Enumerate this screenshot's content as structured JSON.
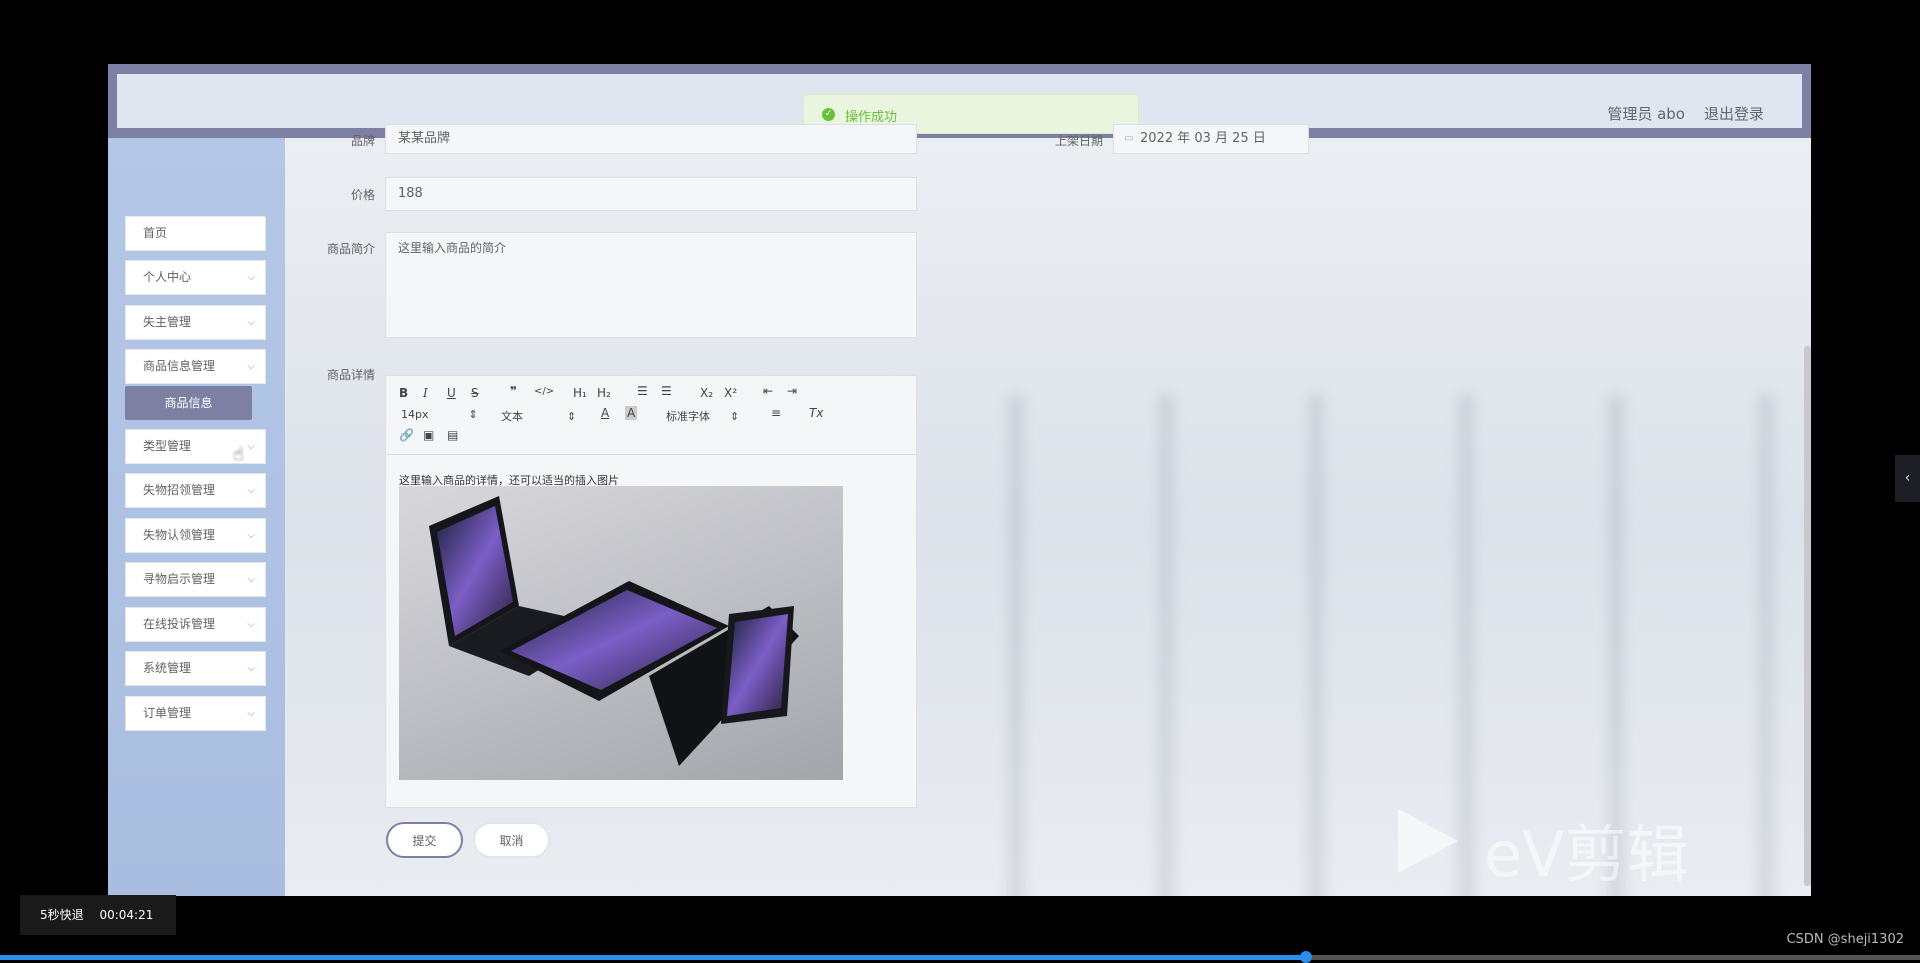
{
  "header": {
    "admin_label": "管理员 abo",
    "logout_label": "退出登录"
  },
  "toast": {
    "message": "操作成功"
  },
  "sidebar": {
    "items": [
      {
        "label": "首页",
        "has_arrow": false
      },
      {
        "label": "个人中心",
        "has_arrow": true
      },
      {
        "label": "失主管理",
        "has_arrow": true
      },
      {
        "label": "商品信息管理",
        "has_arrow": true
      },
      {
        "label": "类型管理",
        "has_arrow": true
      },
      {
        "label": "失物招领管理",
        "has_arrow": true
      },
      {
        "label": "失物认领管理",
        "has_arrow": true
      },
      {
        "label": "寻物启示管理",
        "has_arrow": true
      },
      {
        "label": "在线投诉管理",
        "has_arrow": true
      },
      {
        "label": "系统管理",
        "has_arrow": true
      },
      {
        "label": "订单管理",
        "has_arrow": true
      }
    ],
    "submenu_label": "商品信息"
  },
  "form": {
    "brand_label": "品牌",
    "brand_value": "某某品牌",
    "date_label": "上架日期",
    "date_value": "2022 年 03 月 25 日",
    "price_label": "价格",
    "price_value": "188",
    "intro_label": "商品简介",
    "intro_value": "这里输入商品的简介",
    "detail_label": "商品详情",
    "detail_text": "这里输入商品的详情，还可以适当的插入图片"
  },
  "toolbar": {
    "font_size": "14px",
    "paragraph": "文本",
    "font_family": "标准字体"
  },
  "actions": {
    "submit_label": "提交",
    "cancel_label": "取消"
  },
  "watermark": "eV剪辑",
  "player": {
    "fast_back_label": "5秒快退",
    "timestamp": "00:04:21",
    "progress": 0.68
  },
  "credit": "CSDN @sheji1302",
  "colors": {
    "accent": "#7d7fa3",
    "success": "#67c23a",
    "sidebar": "#b4c7e6"
  }
}
